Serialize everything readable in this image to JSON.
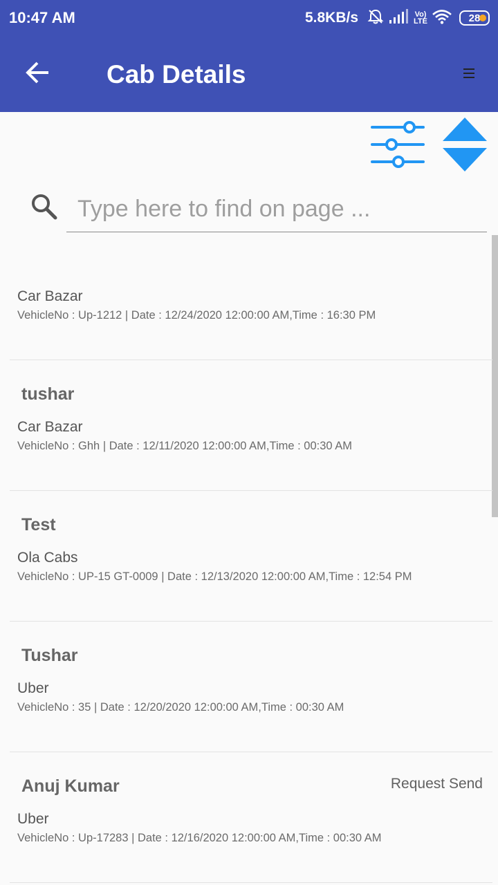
{
  "status_bar": {
    "time": "10:47 AM",
    "net_speed": "5.8KB/s",
    "volte": [
      "Vo)",
      "LTE"
    ],
    "battery": "28",
    "icons": [
      "alarm-off-icon",
      "signal-icon",
      "wifi-icon",
      "battery-icon"
    ]
  },
  "toolbar": {
    "title": "Cab Details",
    "back_icon": "arrow-left-icon",
    "menu_icon": "menu-icon"
  },
  "actions": {
    "filter_icon": "sliders-icon",
    "sort_icon": "sort-up-down-icon",
    "accent_color": "#2196f3"
  },
  "search": {
    "placeholder": "Type here to find on page ...",
    "value": ""
  },
  "bookings": [
    {
      "name": "",
      "status": "",
      "company": "Car Bazar",
      "details": "VehicleNo : Up-1212 | Date : 12/24/2020 12:00:00 AM,Time : 16:30 PM"
    },
    {
      "name": "tushar",
      "status": "",
      "company": "Car Bazar",
      "details": "VehicleNo : Ghh | Date : 12/11/2020 12:00:00 AM,Time : 00:30 AM"
    },
    {
      "name": "Test",
      "status": "",
      "company": "Ola Cabs",
      "details": "VehicleNo : UP-15 GT-0009 | Date : 12/13/2020 12:00:00 AM,Time : 12:54 PM"
    },
    {
      "name": "Tushar",
      "status": "",
      "company": "Uber",
      "details": "VehicleNo : 35 | Date : 12/20/2020 12:00:00 AM,Time : 00:30 AM"
    },
    {
      "name": "Anuj Kumar",
      "status": "Request Send",
      "company": "Uber",
      "details": "VehicleNo : Up-17283 | Date : 12/16/2020 12:00:00 AM,Time : 00:30 AM"
    }
  ],
  "colors": {
    "app_bar": "#3f51b5",
    "background": "#fafafa"
  }
}
